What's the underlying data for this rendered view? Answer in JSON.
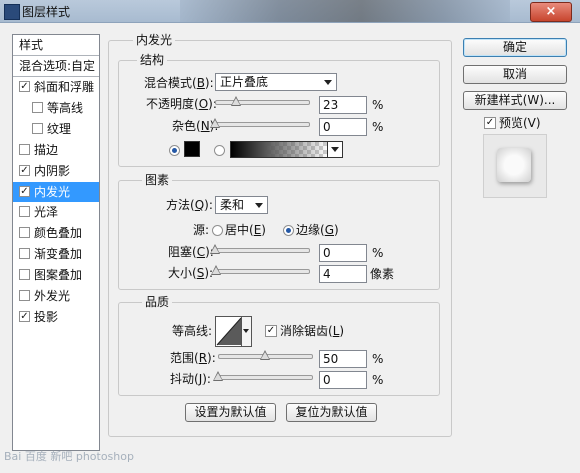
{
  "window": {
    "title": "图层样式",
    "close_label": "×"
  },
  "left": {
    "header": "样式",
    "blend_options": "混合选项:自定",
    "items": [
      {
        "label": "斜面和浮雕",
        "checked": true,
        "indent": false,
        "selected": false
      },
      {
        "label": "等高线",
        "checked": false,
        "indent": true,
        "selected": false
      },
      {
        "label": "纹理",
        "checked": false,
        "indent": true,
        "selected": false
      },
      {
        "label": "描边",
        "checked": false,
        "indent": false,
        "selected": false
      },
      {
        "label": "内阴影",
        "checked": true,
        "indent": false,
        "selected": false
      },
      {
        "label": "内发光",
        "checked": true,
        "indent": false,
        "selected": true
      },
      {
        "label": "光泽",
        "checked": false,
        "indent": false,
        "selected": false
      },
      {
        "label": "颜色叠加",
        "checked": false,
        "indent": false,
        "selected": false
      },
      {
        "label": "渐变叠加",
        "checked": false,
        "indent": false,
        "selected": false
      },
      {
        "label": "图案叠加",
        "checked": false,
        "indent": false,
        "selected": false
      },
      {
        "label": "外发光",
        "checked": false,
        "indent": false,
        "selected": false
      },
      {
        "label": "投影",
        "checked": true,
        "indent": false,
        "selected": false
      }
    ]
  },
  "inner_glow": {
    "title": "内发光",
    "structure": {
      "title": "结构",
      "blend_mode_label_pre": "混合模式(",
      "blend_mode_label_key": "B",
      "blend_mode_label_post": "):",
      "blend_mode_value": "正片叠底",
      "opacity_label_pre": "不透明度(",
      "opacity_label_key": "O",
      "opacity_label_post": "):",
      "opacity_value": "23",
      "opacity_fraction": 0.23,
      "opacity_unit": "%",
      "noise_label_pre": "杂色(",
      "noise_label_key": "N",
      "noise_label_post": "):",
      "noise_value": "0",
      "noise_fraction": 0,
      "noise_unit": "%",
      "color_swatch": "#000000"
    },
    "elements": {
      "title": "图素",
      "method_label_pre": "方法(",
      "method_label_key": "Q",
      "method_label_post": "):",
      "method_value": "柔和",
      "source_label": "源:",
      "center_label_pre": "居中(",
      "center_label_key": "E",
      "center_label_post": ")",
      "edge_label_pre": "边缘(",
      "edge_label_key": "G",
      "edge_label_post": ")",
      "choke_label_pre": "阻塞(",
      "choke_label_key": "C",
      "choke_label_post": "):",
      "choke_value": "0",
      "choke_fraction": 0,
      "choke_unit": "%",
      "size_label_pre": "大小(",
      "size_label_key": "S",
      "size_label_post": "):",
      "size_value": "4",
      "size_fraction": 0.016,
      "size_unit": "像素"
    },
    "quality": {
      "title": "品质",
      "contour_label": "等高线:",
      "antialias_label_pre": "消除锯齿(",
      "antialias_label_key": "L",
      "antialias_label_post": ")",
      "range_label_pre": "范围(",
      "range_label_key": "R",
      "range_label_post": "):",
      "range_value": "50",
      "range_fraction": 0.5,
      "range_unit": "%",
      "jitter_label_pre": "抖动(",
      "jitter_label_key": "J",
      "jitter_label_post": "):",
      "jitter_value": "0",
      "jitter_fraction": 0,
      "jitter_unit": "%"
    },
    "set_default": "设置为默认值",
    "reset_default": "复位为默认值"
  },
  "right": {
    "ok": "确定",
    "cancel": "取消",
    "new_style": "新建样式(W)...",
    "preview": "预览(V)"
  },
  "watermark": "Bai 百度 新吧 photoshop"
}
